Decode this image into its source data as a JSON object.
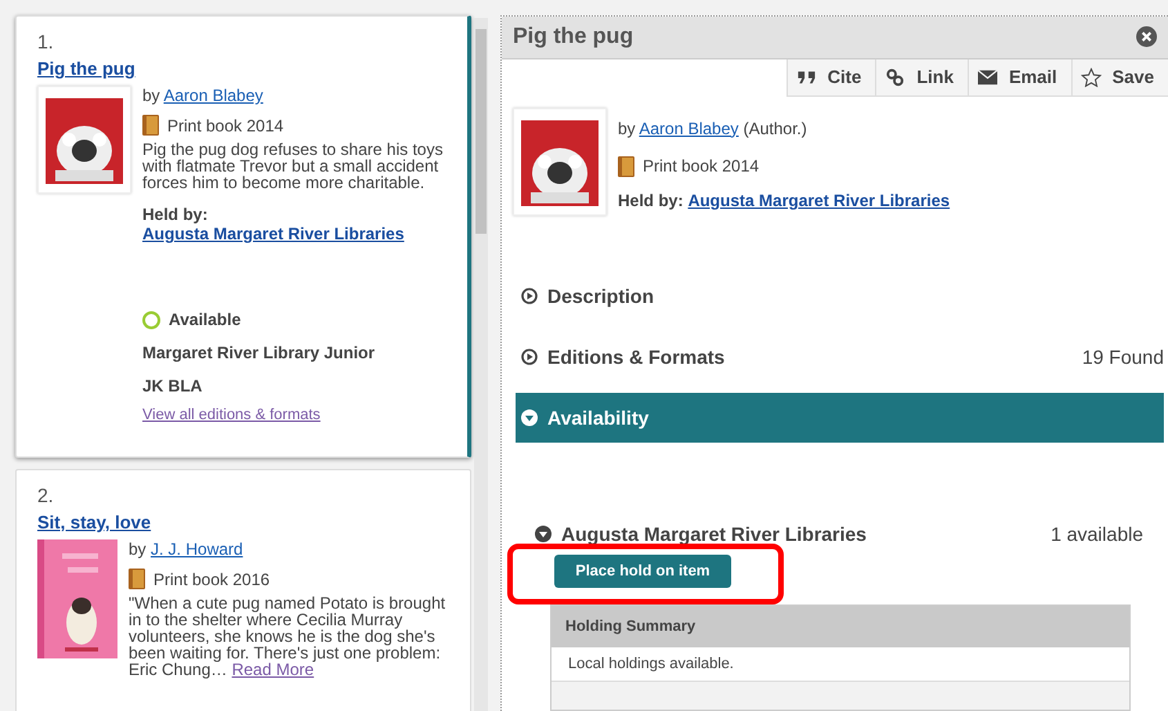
{
  "results": [
    {
      "number": "1.",
      "title": "Pig the pug",
      "by": "by",
      "author": "Aaron Blabey",
      "format": "Print book 2014",
      "summary": "Pig the pug dog refuses to share his toys with flatmate Trevor but a small accident forces him to become more charitable.",
      "held_by_label": "Held by:",
      "held_by": "Augusta Margaret River Libraries",
      "status": "Available",
      "location": "Margaret River Library Junior",
      "call_number": "JK BLA",
      "editions_link": "View all editions & formats",
      "selected": true
    },
    {
      "number": "2.",
      "title": "Sit, stay, love",
      "by": "by",
      "author": "J. J. Howard",
      "format": "Print book 2016",
      "summary": "\"When a cute pug named Potato is brought in to the shelter where Cecilia Murray volunteers, she knows he is the dog she's been waiting for. There's just one problem: Eric Chung…",
      "read_more": "Read More",
      "selected": false
    }
  ],
  "detail": {
    "title": "Pig the pug",
    "actions": [
      {
        "kind": "cite",
        "label": "Cite"
      },
      {
        "kind": "link",
        "label": "Link"
      },
      {
        "kind": "email",
        "label": "Email"
      },
      {
        "kind": "save",
        "label": "Save"
      }
    ],
    "by": "by",
    "author": "Aaron Blabey",
    "role": "(Author.)",
    "format": "Print book 2014",
    "held_by_label": "Held by:",
    "held_by": "Augusta Margaret River Libraries",
    "sections": [
      {
        "label": "Description",
        "expanded": false
      },
      {
        "label": "Editions & Formats",
        "count": "19 Found",
        "expanded": false
      },
      {
        "label": "Availability",
        "expanded": true
      }
    ],
    "library": {
      "name": "Augusta Margaret River Libraries",
      "count": "1 available",
      "expanded": true
    },
    "hold_button": "Place hold on item",
    "highlighted": true,
    "holding": {
      "heading": "Holding Summary",
      "text": "Local holdings available."
    }
  }
}
